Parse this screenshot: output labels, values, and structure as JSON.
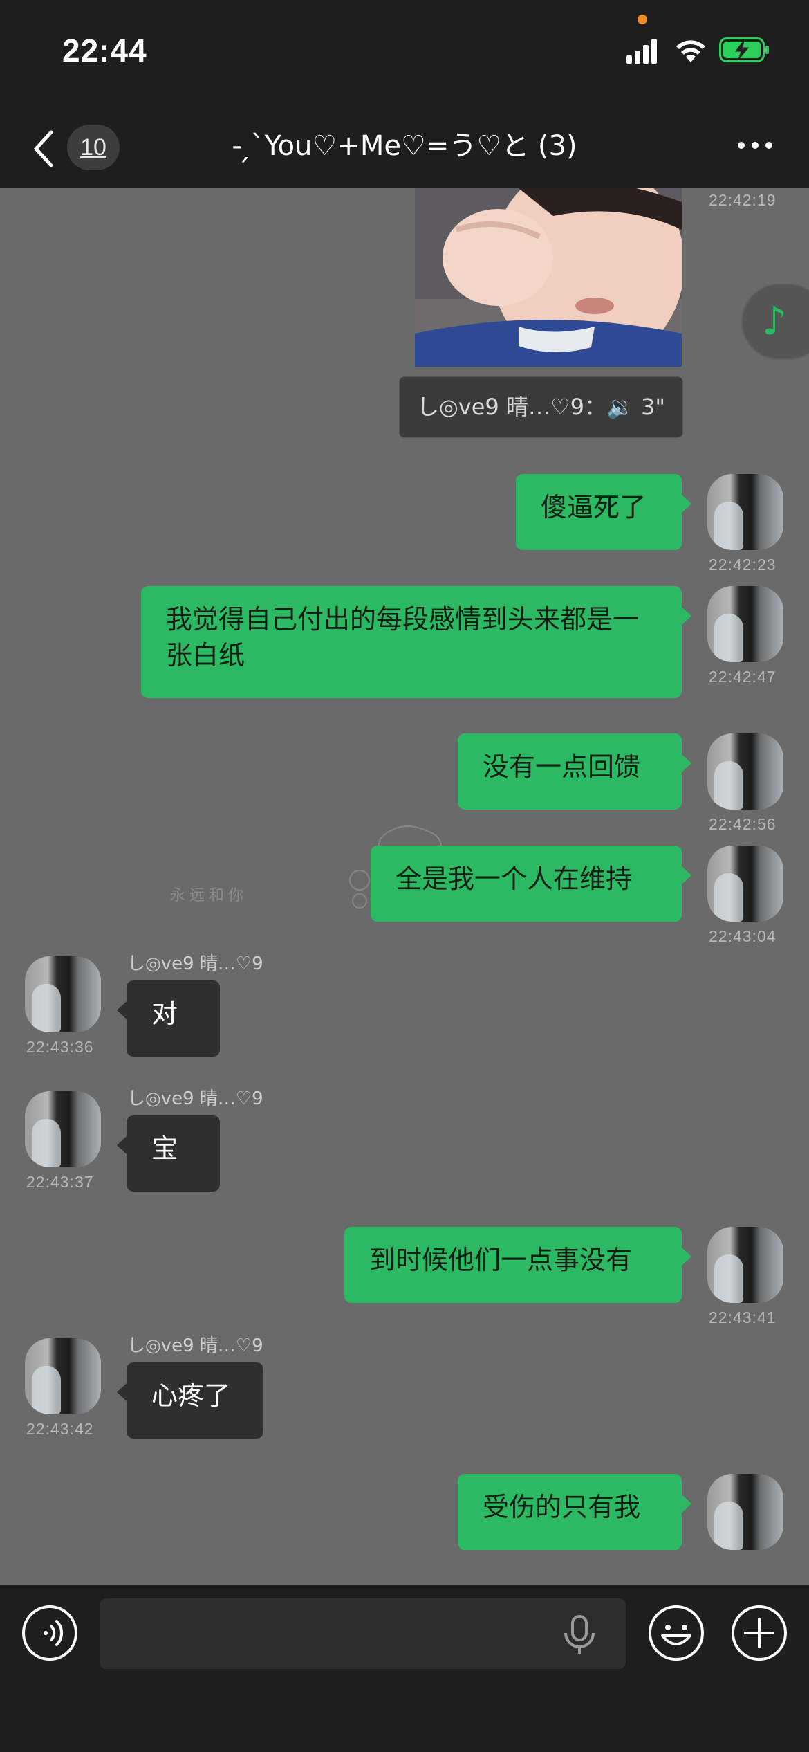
{
  "status": {
    "time": "22:44"
  },
  "header": {
    "back_count": "10",
    "title": "- ̗`You♡+Me♡=う♡と (3)"
  },
  "messages": [
    {
      "time": "22:42:19"
    },
    {
      "quote": "し◎ve9 晴…♡9：🔉 3\""
    },
    {
      "text": "傻逼死了",
      "time": "22:42:23"
    },
    {
      "text": "我觉得自己付出的每段感情到头来都是一张白纸",
      "time": "22:42:47"
    },
    {
      "text": "没有一点回馈",
      "time": "22:42:56"
    },
    {
      "text": "全是我一个人在维持",
      "time": "22:43:04"
    },
    {
      "sender": "し◎ve9 晴…♡9",
      "text": "对",
      "time": "22:43:36"
    },
    {
      "sender": "し◎ve9 晴…♡9",
      "text": "宝",
      "time": "22:43:37"
    },
    {
      "text": "到时候他们一点事没有",
      "time": "22:43:41"
    },
    {
      "sender": "し◎ve9 晴…♡9",
      "text": "心疼了",
      "time": "22:43:42"
    },
    {
      "text": "受伤的只有我"
    }
  ],
  "wallpaper": {
    "text": "永远和你"
  },
  "colors": {
    "bubble_self": "#2bba63",
    "bubble_other": "#2f2f2f",
    "background": "#6a6a6a",
    "bar": "#1e1e1e"
  },
  "icons": [
    "back-icon",
    "more-icon",
    "music-note-icon",
    "voice-icon",
    "mic-icon",
    "emoji-icon",
    "plus-icon"
  ]
}
